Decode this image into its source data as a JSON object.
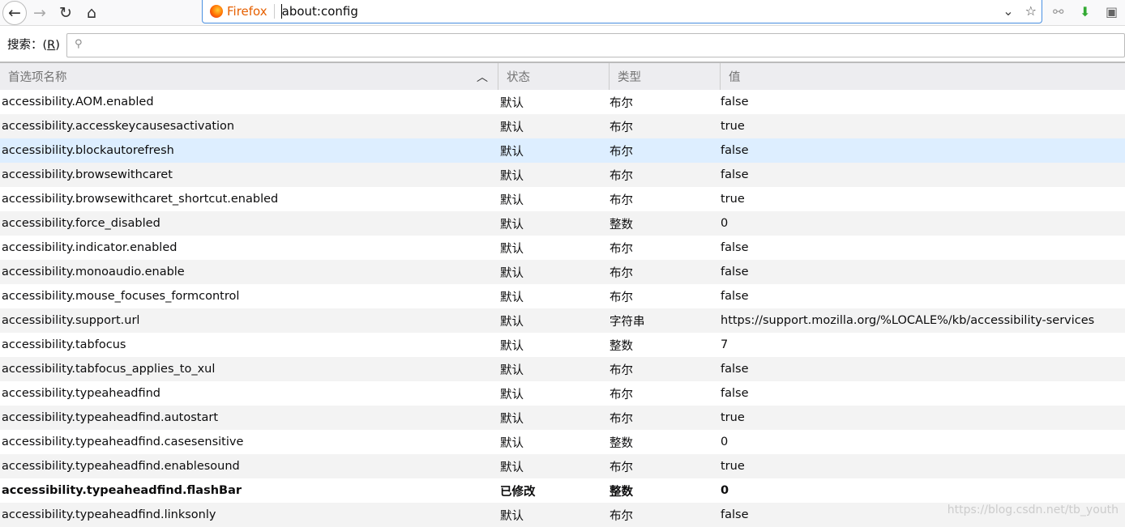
{
  "toolbar": {
    "brand": "Firefox",
    "url": "about:config"
  },
  "search": {
    "label": "搜索：(",
    "accesskey": "R",
    "label_end": ")",
    "placeholder": ""
  },
  "columns": [
    "首选项名称",
    "状态",
    "类型",
    "值"
  ],
  "rows": [
    {
      "name": "accessibility.AOM.enabled",
      "status": "默认",
      "type": "布尔",
      "value": "false"
    },
    {
      "name": "accessibility.accesskeycausesactivation",
      "status": "默认",
      "type": "布尔",
      "value": "true"
    },
    {
      "name": "accessibility.blockautorefresh",
      "status": "默认",
      "type": "布尔",
      "value": "false",
      "selected": true
    },
    {
      "name": "accessibility.browsewithcaret",
      "status": "默认",
      "type": "布尔",
      "value": "false"
    },
    {
      "name": "accessibility.browsewithcaret_shortcut.enabled",
      "status": "默认",
      "type": "布尔",
      "value": "true"
    },
    {
      "name": "accessibility.force_disabled",
      "status": "默认",
      "type": "整数",
      "value": "0"
    },
    {
      "name": "accessibility.indicator.enabled",
      "status": "默认",
      "type": "布尔",
      "value": "false"
    },
    {
      "name": "accessibility.monoaudio.enable",
      "status": "默认",
      "type": "布尔",
      "value": "false"
    },
    {
      "name": "accessibility.mouse_focuses_formcontrol",
      "status": "默认",
      "type": "布尔",
      "value": "false"
    },
    {
      "name": "accessibility.support.url",
      "status": "默认",
      "type": "字符串",
      "value": "https://support.mozilla.org/%LOCALE%/kb/accessibility-services"
    },
    {
      "name": "accessibility.tabfocus",
      "status": "默认",
      "type": "整数",
      "value": "7"
    },
    {
      "name": "accessibility.tabfocus_applies_to_xul",
      "status": "默认",
      "type": "布尔",
      "value": "false"
    },
    {
      "name": "accessibility.typeaheadfind",
      "status": "默认",
      "type": "布尔",
      "value": "false"
    },
    {
      "name": "accessibility.typeaheadfind.autostart",
      "status": "默认",
      "type": "布尔",
      "value": "true"
    },
    {
      "name": "accessibility.typeaheadfind.casesensitive",
      "status": "默认",
      "type": "整数",
      "value": "0"
    },
    {
      "name": "accessibility.typeaheadfind.enablesound",
      "status": "默认",
      "type": "布尔",
      "value": "true"
    },
    {
      "name": "accessibility.typeaheadfind.flashBar",
      "status": "已修改",
      "type": "整数",
      "value": "0",
      "modified": true
    },
    {
      "name": "accessibility.typeaheadfind.linksonly",
      "status": "默认",
      "type": "布尔",
      "value": "false"
    }
  ],
  "watermark": "https://blog.csdn.net/tb_youth"
}
